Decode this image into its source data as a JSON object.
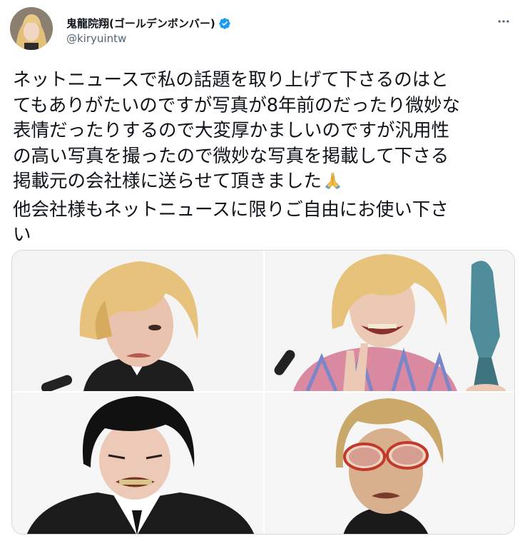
{
  "author": {
    "display_name": "鬼龍院翔(ゴールデンボンバー)",
    "handle": "@kiryuintw",
    "verified": true,
    "avatar": "avatar-photo"
  },
  "tweet": {
    "lines": [
      "ネットニュースで私の話題を取り上げて下さるのはと",
      "てもありがたいのですが写真が8年前のだったり微妙な",
      "表情だったりするので大変厚かましいのですが汎用性",
      "の高い写真を撮ったので微妙な写真を掲載して下さる",
      "掲載元の会社様に送らせて頂きました",
      "他会社様もネットニュースに限りご自由にお使い下さ",
      "い"
    ],
    "emoji": "folded-hands-emoji"
  },
  "media": {
    "photos": [
      {
        "icon": "photo-blonde-bob-frown"
      },
      {
        "icon": "photo-blonde-smile-peace-sign-trophy"
      },
      {
        "icon": "photo-black-hair-grimace-suit"
      },
      {
        "icon": "photo-gold-hair-sunglasses"
      }
    ]
  },
  "colors": {
    "text": "#0f1419",
    "secondary": "#536471",
    "verified": "#1d9bf0",
    "border": "#cfd9de"
  }
}
